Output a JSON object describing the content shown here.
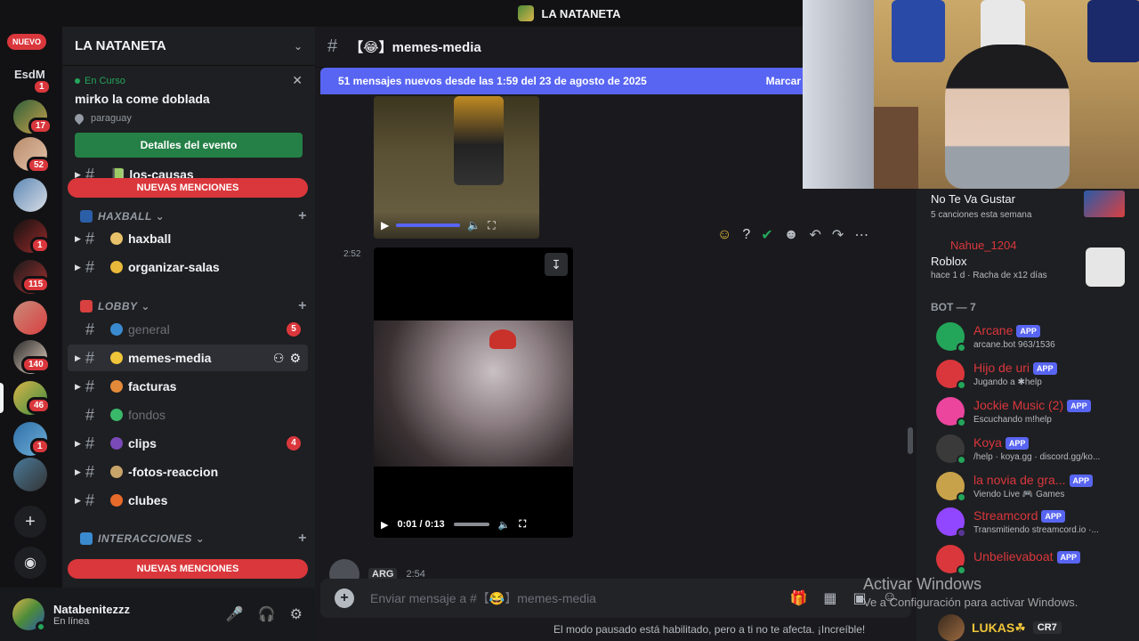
{
  "window": {
    "title": "LA NATANETA"
  },
  "rail": {
    "nuevo_label": "NUEVO",
    "esdm_label": "EsdM",
    "servers": [
      {
        "badge": "1"
      },
      {
        "badge": "17"
      },
      {
        "badge": "52"
      },
      {
        "badge": ""
      },
      {
        "badge": "1"
      },
      {
        "badge": "115"
      },
      {
        "badge": ""
      },
      {
        "badge": "140"
      },
      {
        "badge": "46"
      },
      {
        "badge": "1"
      },
      {
        "badge": ""
      }
    ]
  },
  "sidebar": {
    "server_name": "LA NATANETA",
    "event": {
      "status": "En Curso",
      "title": "mirko la come doblada",
      "location": "paraguay",
      "button": "Detalles del evento"
    },
    "mention_pill": "NUEVAS MENCIONES",
    "partial_channel": "📗 los-causas",
    "categories": [
      "HAXBALL",
      "LOBBY",
      "INTERACCIONES"
    ],
    "channels": [
      {
        "name": "haxball",
        "badge": ""
      },
      {
        "name": "organizar-salas",
        "badge": ""
      },
      {
        "name": "general",
        "badge": "5"
      },
      {
        "name": "memes-media",
        "badge": ""
      },
      {
        "name": "facturas",
        "badge": ""
      },
      {
        "name": "fondos",
        "badge": ""
      },
      {
        "name": "clips",
        "badge": "4"
      },
      {
        "name": "-fotos-reaccion",
        "badge": ""
      },
      {
        "name": "clubes",
        "badge": ""
      }
    ]
  },
  "user": {
    "name": "Natabenitezzz",
    "status": "En línea"
  },
  "chat": {
    "channel": "【😂】memes-media",
    "new_messages": "51 mensajes nuevos desde las 1:59 del 23 de agosto de 2025",
    "mark": "Marcar",
    "timestamp1": "2:52",
    "video_time": "0:01 / 0:13",
    "next_author_tag": "ARG",
    "next_time": "2:54",
    "composer_placeholder": "Enviar mensaje a #【😂】memes-media",
    "slowmode": "El modo pausado está habilitado, pero a ti no te afecta. ¡Increíble!"
  },
  "members": {
    "top_song": {
      "title": "No Te Va Gustar",
      "sub": "5 canciones esta semana"
    },
    "roblox": {
      "user": "Nahue_1204",
      "game": "Roblox",
      "sub": "hace 1 d  ·  Racha de x12 días"
    },
    "bot_header": "BOT — 7",
    "app_label": "APP",
    "bots": [
      {
        "name": "Arcane",
        "sub": "arcane.bot 963/1536",
        "color": "#23a55a"
      },
      {
        "name": "Hijo de uri",
        "sub": "Jugando a ✱help",
        "color": "#da373c"
      },
      {
        "name": "Jockie Music (2)",
        "sub": "Escuchando m!help",
        "color": "#eb459e"
      },
      {
        "name": "Koya",
        "sub": "/help · koya.gg · discord.gg/ko...",
        "color": "#3a3a3a"
      },
      {
        "name": "la novia de gra...",
        "sub": "Viendo Live 🎮 Games",
        "color": "#c8a24a"
      },
      {
        "name": "Streamcord",
        "sub": "Transmitiendo streamcord.io ·...",
        "color": "#9146ff"
      },
      {
        "name": "Unbelievaboat",
        "sub": "",
        "color": "#da373c"
      }
    ]
  },
  "watermark": {
    "line1": "Activar Windows",
    "line2": "Ve a Configuración para activar Windows."
  },
  "bottom_member": {
    "name": "LUKAS☘",
    "tag": "CR7"
  }
}
